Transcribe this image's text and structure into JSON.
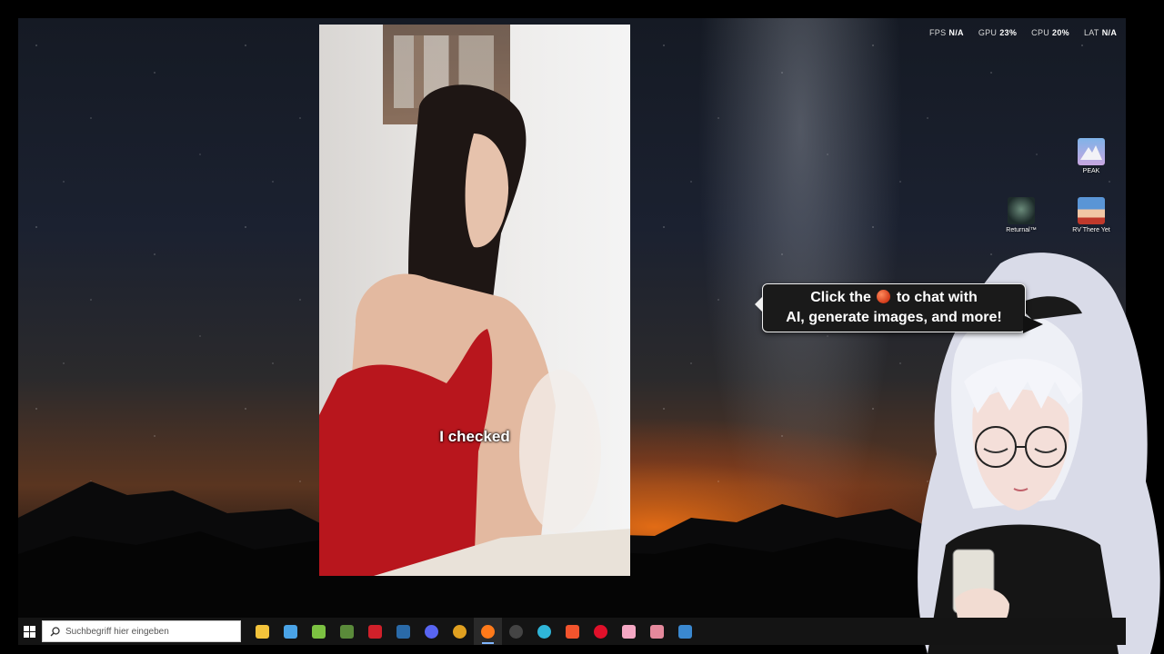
{
  "perf_overlay": [
    {
      "key": "FPS",
      "value": "N/A"
    },
    {
      "key": "GPU",
      "value": "23%"
    },
    {
      "key": "CPU",
      "value": "20%"
    },
    {
      "key": "LAT",
      "value": "N/A"
    }
  ],
  "desktop_icons": {
    "peak": {
      "label": "PEAK",
      "icon": "peak-game-icon"
    },
    "returnal": {
      "label": "Returnal™",
      "icon": "returnal-game-icon"
    },
    "rv": {
      "label": "RV There Yet",
      "icon": "rv-there-yet-game-icon"
    }
  },
  "video": {
    "caption": "I checked"
  },
  "assistant_bubble": {
    "line1_before": "Click the",
    "line1_after": "to chat with",
    "line2": "AI, generate images, and more!"
  },
  "taskbar": {
    "search_placeholder": "Suchbegriff hier eingeben",
    "apps": [
      {
        "name": "file-explorer-icon",
        "color": "#f3c33b"
      },
      {
        "name": "store-icon",
        "color": "#4aa3e6"
      },
      {
        "name": "android-app-icon",
        "color": "#7cc142"
      },
      {
        "name": "minecraft-icon",
        "color": "#5a8a3a"
      },
      {
        "name": "msi-afterburner-icon",
        "color": "#d0202a"
      },
      {
        "name": "steam-icon",
        "color": "#2a6aa8"
      },
      {
        "name": "discord-icon",
        "color": "#5865f2"
      },
      {
        "name": "chrome-icon",
        "color": "#e0a020"
      },
      {
        "name": "firefox-icon",
        "color": "#ff7a1a"
      },
      {
        "name": "obs-icon",
        "color": "#444444"
      },
      {
        "name": "edge-icon",
        "color": "#2fb5d8"
      },
      {
        "name": "brave-icon",
        "color": "#f2542d"
      },
      {
        "name": "opera-icon",
        "color": "#e0102a"
      },
      {
        "name": "anime-app-icon",
        "color": "#f4a7c3"
      },
      {
        "name": "usb-tool-icon",
        "color": "#e4899c"
      },
      {
        "name": "steam-alt-icon",
        "color": "#3a88d0"
      }
    ]
  }
}
